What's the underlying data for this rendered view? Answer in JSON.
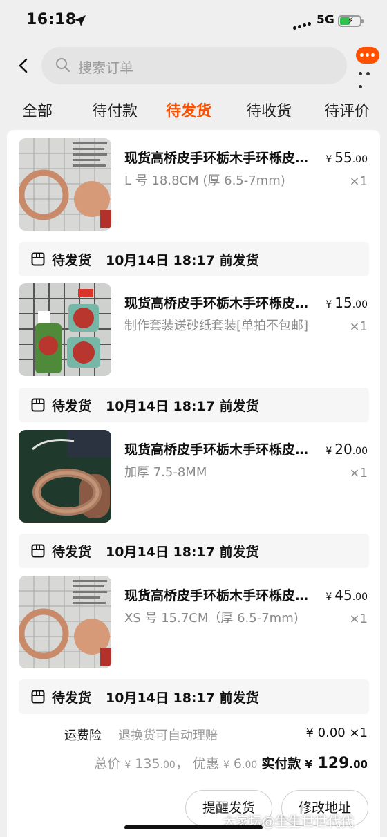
{
  "status_bar": {
    "time": "16:18",
    "network": "5G"
  },
  "search": {
    "placeholder": "搜索订单"
  },
  "tabs": [
    {
      "label": "全部"
    },
    {
      "label": "待付款"
    },
    {
      "label": "待发货",
      "active": true
    },
    {
      "label": "待收货"
    },
    {
      "label": "待评价"
    }
  ],
  "items": [
    {
      "title": "现货高桥皮手环栃木手环栎皮手环",
      "spec": "L 号 18.8CM (厚 6.5-7mm)",
      "price_currency": "¥",
      "price_int": "55",
      "price_dec": ".00",
      "qty": "×1"
    },
    {
      "title": "现货高桥皮手环栃木手环栎皮手环",
      "spec": "制作套装送砂纸套装[单拍不包邮]",
      "price_currency": "¥",
      "price_int": "15",
      "price_dec": ".00",
      "qty": "×1"
    },
    {
      "title": "现货高桥皮手环栃木手环栎皮手环",
      "spec": "加厚 7.5-8MM",
      "price_currency": "¥",
      "price_int": "20",
      "price_dec": ".00",
      "qty": "×1"
    },
    {
      "title": "现货高桥皮手环栃木手环栎皮手环",
      "spec": "XS 号 15.7CM（厚 6.5-7mm)",
      "price_currency": "¥",
      "price_int": "45",
      "price_dec": ".00",
      "qty": "×1"
    }
  ],
  "shipping": [
    {
      "status": "待发货",
      "deadline": "10月14日 18:17 前发货"
    },
    {
      "status": "待发货",
      "deadline": "10月14日 18:17 前发货"
    },
    {
      "status": "待发货",
      "deadline": "10月14日 18:17 前发货"
    },
    {
      "status": "待发货",
      "deadline": "10月14日 18:17 前发货"
    }
  ],
  "insurance": {
    "label": "运费险",
    "desc": "退换货可自动理赔",
    "price": "¥ 0.00 ×1"
  },
  "totals": {
    "total_label": "总价",
    "total_cur": "¥",
    "total_int": "135",
    "total_dec": ".00",
    "sep": "，",
    "discount_label": "优惠",
    "discount_cur": "¥",
    "discount_int": "6",
    "discount_dec": ".00",
    "paid_label": "实付款",
    "paid_cur": "¥",
    "paid_int": "129",
    "paid_dec": ".00"
  },
  "actions": {
    "remind": "提醒发货",
    "edit_address": "修改地址"
  },
  "watermark": "大家坛@生生世世代代",
  "colors": {
    "accent": "#ff5000",
    "background": "#efefef",
    "muted": "#8a8a8a"
  }
}
